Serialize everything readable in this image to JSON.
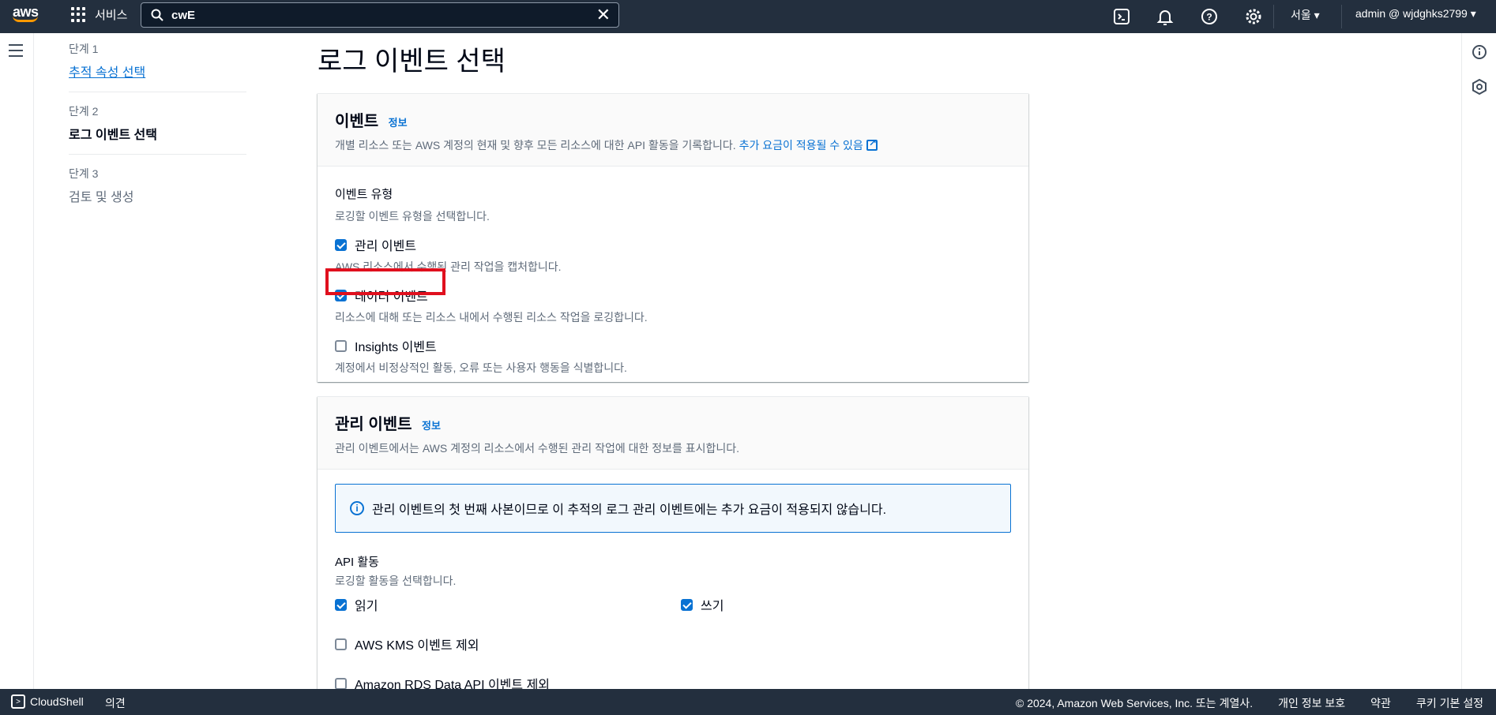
{
  "nav": {
    "logo_text": "aws",
    "services_label": "서비스",
    "search_value": "cwE",
    "region": "서울 ▾",
    "account": "admin @ wjdghks2799 ▾",
    "icons": [
      "cloudshell-icon",
      "bell-icon",
      "help-icon",
      "gear-icon"
    ]
  },
  "steps": [
    {
      "num": "단계 1",
      "label": "추적 속성 선택",
      "state": "link"
    },
    {
      "num": "단계 2",
      "label": "로그 이벤트 선택",
      "state": "active"
    },
    {
      "num": "단계 3",
      "label": "검토 및 생성",
      "state": "disabled"
    }
  ],
  "page_title": "로그 이벤트 선택",
  "events_section": {
    "title": "이벤트",
    "info": "정보",
    "desc": "개별 리소스 또는 AWS 계정의 현재 및 향후 모든 리소스에 대한 API 활동을 기록합니다.",
    "desc_link": "추가 요금이 적용될 수 있음",
    "field_label": "이벤트 유형",
    "field_desc": "로깅할 이벤트 유형을 선택합니다.",
    "options": [
      {
        "label": "관리 이벤트",
        "desc": "AWS 리소스에서 수행된 관리 작업을 캡처합니다.",
        "checked": true
      },
      {
        "label": "데이터 이벤트",
        "desc": "리소스에 대해 또는 리소스 내에서 수행된 리소스 작업을 로깅합니다.",
        "checked": true
      },
      {
        "label": "Insights 이벤트",
        "desc": "계정에서 비정상적인 활동, 오류 또는 사용자 행동을 식별합니다.",
        "checked": false
      }
    ]
  },
  "mgmt_section": {
    "title": "관리 이벤트",
    "info": "정보",
    "desc": "관리 이벤트에서는 AWS 계정의 리소스에서 수행된 관리 작업에 대한 정보를 표시합니다.",
    "alert": "관리 이벤트의 첫 번째 사본이므로 이 추적의 로그 관리 이벤트에는 추가 요금이 적용되지 않습니다.",
    "api_label": "API 활동",
    "api_desc": "로깅할 활동을 선택합니다.",
    "read_label": "읽기",
    "write_label": "쓰기",
    "kms_label": "AWS KMS 이벤트 제외",
    "rds_label": "Amazon RDS Data API 이벤트 제외"
  },
  "footer": {
    "cloudshell": "CloudShell",
    "feedback": "의견",
    "copyright": "© 2024, Amazon Web Services, Inc. 또는 계열사.",
    "privacy": "개인 정보 보호",
    "terms": "약관",
    "cookies": "쿠키 기본 설정"
  }
}
